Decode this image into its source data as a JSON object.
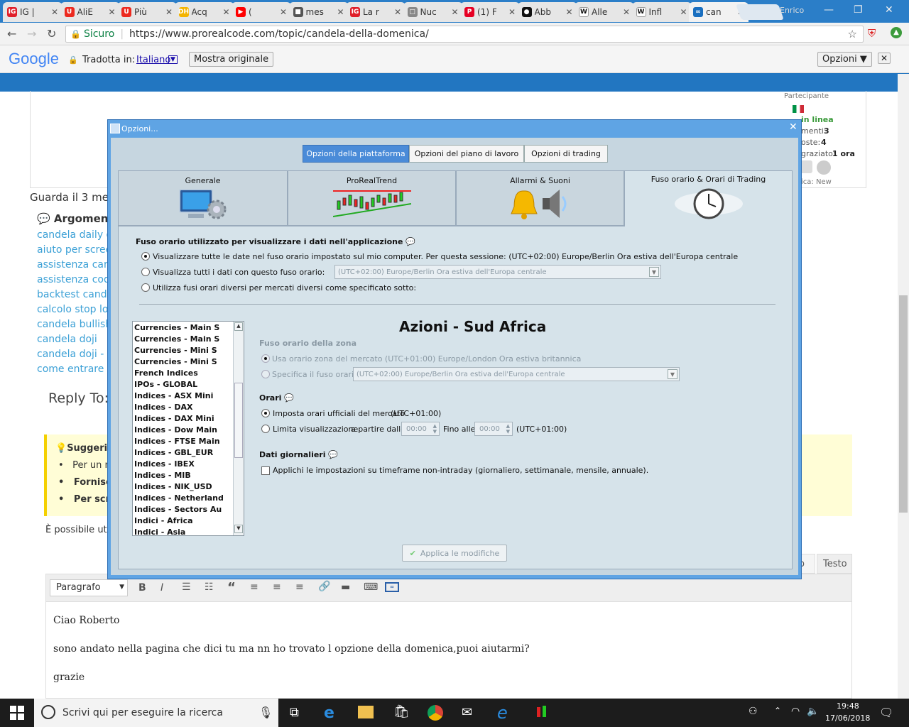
{
  "browser": {
    "tabs": [
      {
        "label": "IG |",
        "fav_color": "#e0202a",
        "fav": "IG"
      },
      {
        "label": "AliE",
        "fav_color": "#ec2a1f",
        "fav": "U"
      },
      {
        "label": "Più",
        "fav_color": "#ec2a1f",
        "fav": "U"
      },
      {
        "label": "Acq",
        "fav_color": "#f4b400",
        "fav": "DH"
      },
      {
        "label": "(",
        "fav_color": "#ff0000",
        "fav": "▶"
      },
      {
        "label": "mes",
        "fav_color": "#555555",
        "fav": "■"
      },
      {
        "label": "La r",
        "fav_color": "#e0202a",
        "fav": "IG"
      },
      {
        "label": "Nuc",
        "fav_color": "#888888",
        "fav": "□"
      },
      {
        "label": "(1) F",
        "fav_color": "#e60023",
        "fav": "P"
      },
      {
        "label": "Abb",
        "fav_color": "#111111",
        "fav": "●"
      },
      {
        "label": "Alle",
        "fav_color": "#ffffff",
        "fav": "W"
      },
      {
        "label": "Infl",
        "fav_color": "#ffffff",
        "fav": "W"
      },
      {
        "label": "can",
        "fav_color": "#1a6fc0",
        "fav": "∞"
      }
    ],
    "profile": "Enrico",
    "secure_label": "Sicuro",
    "url": "https://www.prorealcode.com/topic/candela-della-domenica/"
  },
  "translate": {
    "brand": "Google",
    "translated_in": "Tradotta in:",
    "language": "Italiano",
    "show_original": "Mostra originale",
    "options": "Opzioni ▼",
    "close": "✕"
  },
  "page": {
    "participant": "Partecipante",
    "online": "in linea",
    "stat1": "menti:",
    "stat1_val": "3",
    "stat2": "oste:",
    "stat2_val": "4",
    "stat3": "graziato:",
    "stat3_val": "1 ora",
    "stat4": "ica: New",
    "guarda": "Guarda il 3 me",
    "argomenti": "Argomenti",
    "links": [
      "candela daily de",
      "aiuto per screen",
      "assistenza cand",
      "assistenza codic",
      "backtest candel",
      "calcolo stop loss",
      "candela bullish",
      "candela doji",
      "candela doji - Ho",
      "come entrare a"
    ],
    "reply": "Reply To:",
    "suggerim": "Suggerim",
    "bullets": [
      "Per un nu",
      "Fornisci",
      "Per scriv"
    ],
    "possibile": "È possibile uti",
    "visual_tab": "o",
    "text_tab": "Testo",
    "paragraph": "Paragrafo",
    "editor_lines": [
      "Ciao Roberto",
      "sono andato nella pagina che dici tu ma nn ho trovato l opzione della domenica,puoi aiutarmi?",
      "grazie"
    ]
  },
  "taskbar": {
    "search_placeholder": "Scrivi qui per eseguire la ricerca",
    "time": "19:48",
    "date": "17/06/2018"
  },
  "dialog": {
    "title": "Opzioni...",
    "top_tabs": [
      "Opzioni della piattaforma",
      "Opzioni del piano di lavoro",
      "Opzioni di trading"
    ],
    "big_tabs": [
      "Generale",
      "ProRealTrend",
      "Allarmi & Suoni",
      "Fuso orario & Orari di Trading"
    ],
    "tz_heading": "Fuso orario utilizzato per visualizzare i dati nell'applicazione",
    "tz_opt1": "Visualizzare tutte le date nel fuso orario impostato sul mio computer. Per questa sessione: (UTC+02:00) Europe/Berlin Ora estiva dell'Europa centrale",
    "tz_opt2": "Visualizza tutti i dati con questo fuso orario:",
    "tz_combo": "(UTC+02:00) Europe/Berlin Ora estiva dell'Europa centrale",
    "tz_opt3": "Utilizza fusi orari diversi per mercati diversi come specificato sotto:",
    "markets": [
      "Currencies - Main S",
      "Currencies - Main S",
      "Currencies - Mini S",
      "Currencies - Mini S",
      "French Indices",
      "IPOs - GLOBAL",
      "Indices - ASX Mini",
      "Indices - DAX",
      "Indices - DAX Mini",
      "Indices - Dow Main",
      "Indices - FTSE Main",
      "Indices - GBL_EUR",
      "Indices - IBEX",
      "Indices - MIB",
      "Indices - NIK_USD",
      "Indices - Netherland",
      "Indices - Sectors Au",
      "Indici - Africa",
      "Indici - Asia"
    ],
    "market_title": "Azioni - Sud Africa",
    "zone_heading": "Fuso orario della zona",
    "zone_opt1": "Usa orario zona del mercato (UTC+01:00) Europe/London Ora estiva britannica",
    "zone_opt2": "Specifica il fuso orario:",
    "zone_combo": "(UTC+02:00) Europe/Berlin Ora estiva dell'Europa centrale",
    "hours_heading": "Orari",
    "hours_opt1": "Imposta orari ufficiali del mercato",
    "hours_opt1_tz": "(UTC+01:00)",
    "hours_opt2": "Limita visualizzazione",
    "from_label": "a partire dalle",
    "from_val": "00:00",
    "to_label": "Fino alle",
    "to_val": "00:00",
    "hours_tz": "(UTC+01:00)",
    "daily_heading": "Dati giornalieri",
    "daily_check": "Applichi le impostazioni su timeframe non-intraday (giornaliero, settimanale, mensile, annuale).",
    "apply": "Applica le modifiche"
  }
}
